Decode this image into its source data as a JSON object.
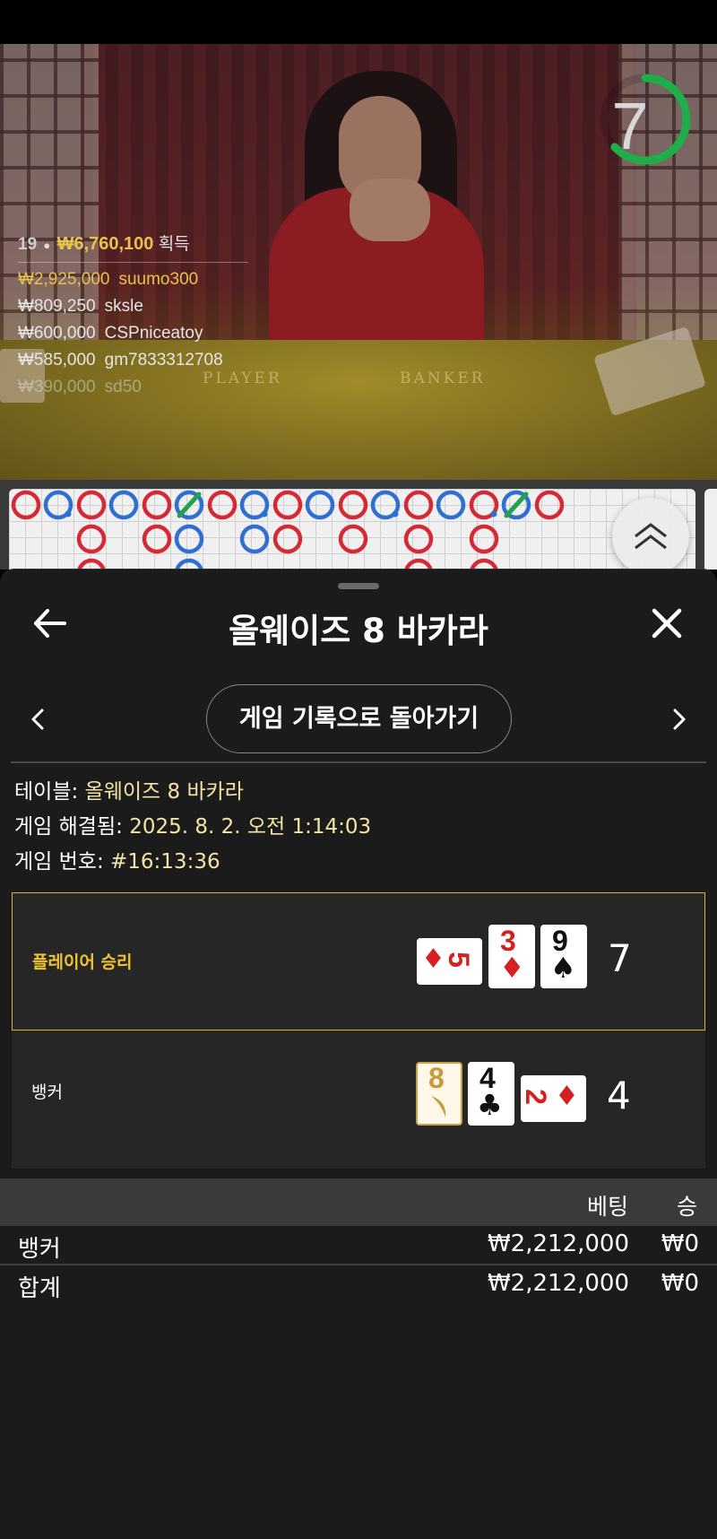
{
  "video": {
    "countdown": "7",
    "felt_player": "PLAYER",
    "felt_banker": "BANKER",
    "winners_summary": {
      "count": "19",
      "total": "₩6,760,100",
      "suffix": "획득"
    },
    "winners": [
      {
        "amount": "₩2,925,000",
        "name": "suumo300"
      },
      {
        "amount": "₩809,250",
        "name": "sksle"
      },
      {
        "amount": "₩600,000",
        "name": "CSPniceatoy"
      },
      {
        "amount": "₩585,000",
        "name": "gm7833312708"
      },
      {
        "amount": "₩390,000",
        "name": "sd50"
      }
    ]
  },
  "roadmap": {
    "colors": {
      "banker": "#d42a35",
      "player": "#2f6fd0",
      "tie": "#22a24a"
    }
  },
  "sheet": {
    "title": "올웨이즈 8 바카라",
    "back_to_history": "게임 기록으로 돌아가기",
    "table_label": "테이블:",
    "table_value": "올웨이즈 8 바카라",
    "resolved_label": "게임 해결됨:",
    "resolved_value": "2025. 8. 2. 오전 1:14:03",
    "game_no_label": "게임 번호:",
    "game_no_value": "#16:13:36"
  },
  "hands": {
    "player": {
      "label": "플레이어 승리",
      "score": "7",
      "cards": [
        {
          "rank": "5",
          "suit": "♦",
          "color": "red",
          "orientation": "sideways"
        },
        {
          "rank": "3",
          "suit": "♦",
          "color": "red",
          "orientation": "upright"
        },
        {
          "rank": "9",
          "suit": "♠",
          "color": "black",
          "orientation": "upright"
        }
      ]
    },
    "banker": {
      "label": "뱅커",
      "score": "4",
      "cards": [
        {
          "rank": "8",
          "suit": "gold",
          "color": "gold",
          "orientation": "upright"
        },
        {
          "rank": "4",
          "suit": "♣",
          "color": "black",
          "orientation": "upright"
        },
        {
          "rank": "2",
          "suit": "♦",
          "color": "red",
          "orientation": "sideways"
        }
      ]
    }
  },
  "bets": {
    "col_bet": "베팅",
    "col_win": "승",
    "rows": [
      {
        "name": "뱅커",
        "bet": "₩2,212,000",
        "win": "₩0"
      }
    ],
    "total": {
      "name": "합계",
      "bet": "₩2,212,000",
      "win": "₩0"
    }
  },
  "colors": {
    "accent_gold": "#f0c52e",
    "info_value": "#f3e3a6",
    "timer_green": "#1fae4a"
  }
}
